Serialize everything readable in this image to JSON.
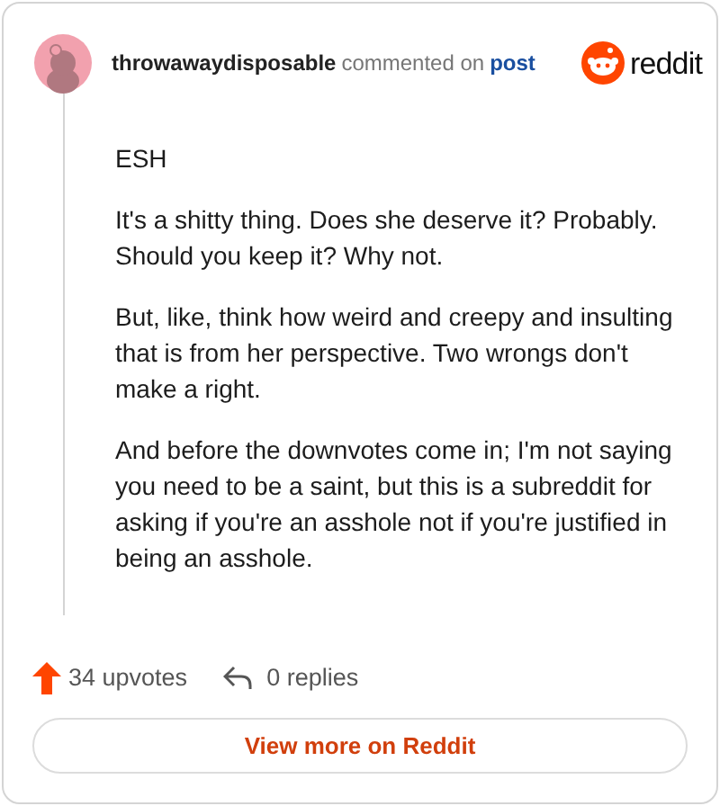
{
  "header": {
    "author": "throwawaydisposable",
    "action": "commented on",
    "link": "post",
    "brand": "reddit"
  },
  "comment": {
    "paragraphs": [
      "ESH",
      "It's a shitty thing. Does she deserve it? Probably. Should you keep it? Why not.",
      "But, like, think how weird and creepy and insulting that is from her perspective. Two wrongs don't make a right.",
      "And before the downvotes come in; I'm not saying you need to be a saint, but this is a subreddit for asking if you're an asshole not if you're justified in being an asshole."
    ]
  },
  "stats": {
    "upvotes": "34 upvotes",
    "replies": "0 replies"
  },
  "button": "View more on Reddit"
}
